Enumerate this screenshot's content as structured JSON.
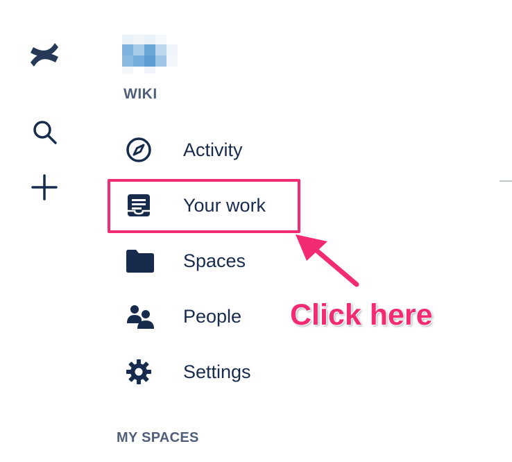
{
  "rail": {
    "logo_icon": "confluence-logo-icon",
    "search_icon": "search-icon",
    "create_icon": "plus-icon"
  },
  "space": {
    "avatar_icon": "space-avatar",
    "name": "WIKI"
  },
  "nav": {
    "items": [
      {
        "label": "Activity",
        "icon": "compass-icon"
      },
      {
        "label": "Your work",
        "icon": "document-tray-icon"
      },
      {
        "label": "Spaces",
        "icon": "folder-icon"
      },
      {
        "label": "People",
        "icon": "people-icon"
      },
      {
        "label": "Settings",
        "icon": "gear-icon"
      }
    ]
  },
  "annotation": {
    "callout_text": "Click here",
    "color": "#f22b73"
  },
  "sections": {
    "my_spaces_heading": "MY SPACES"
  }
}
